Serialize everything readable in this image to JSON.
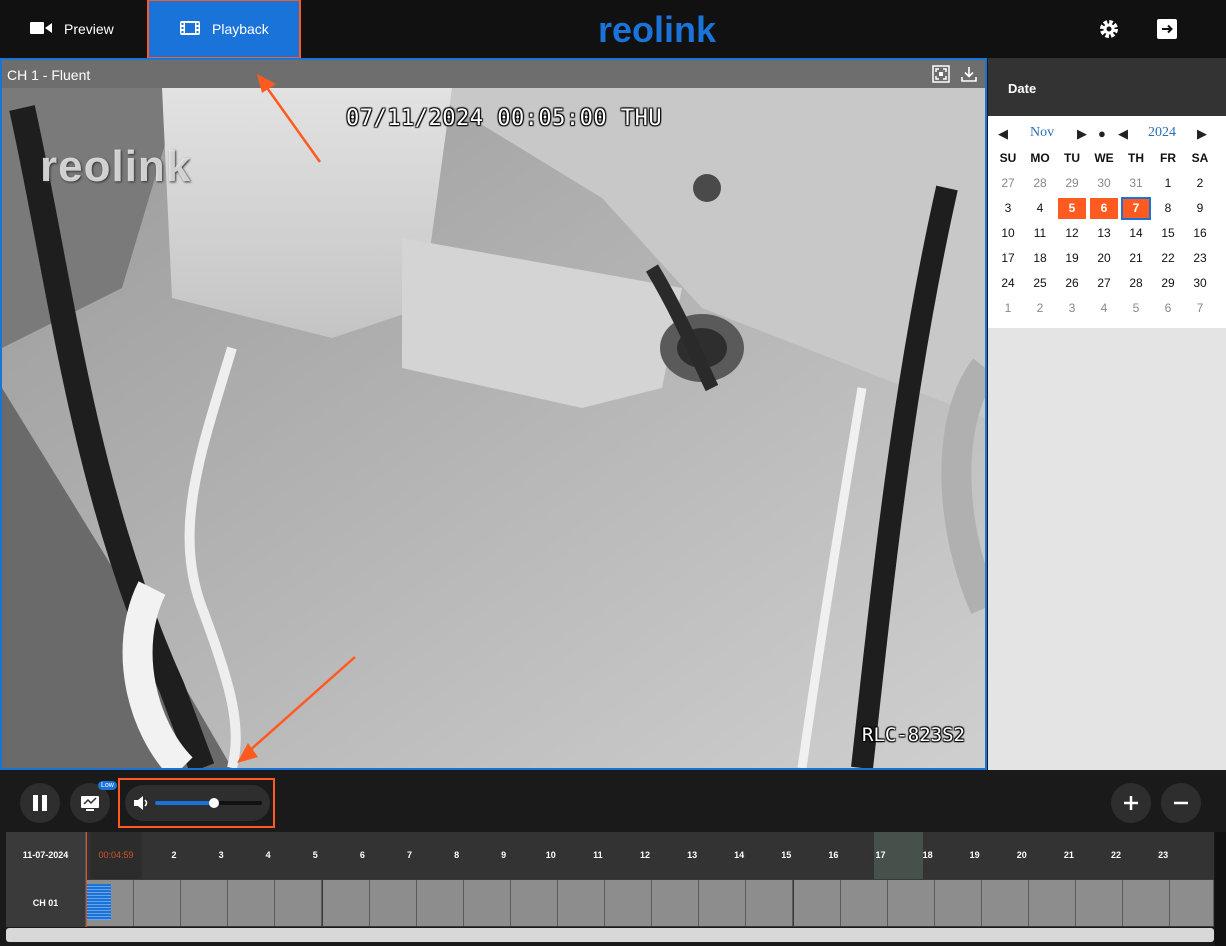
{
  "nav": {
    "preview_label": "Preview",
    "playback_label": "Playback",
    "logo_text": "reolink"
  },
  "video": {
    "title": "CH 1 - Fluent",
    "osd_timestamp": "07/11/2024 00:05:00 THU",
    "osd_model": "RLC-823S2",
    "osd_logo": "reolink"
  },
  "calendar": {
    "header": "Date",
    "month": "Nov",
    "year": "2024",
    "weekdays": [
      "SU",
      "MO",
      "TU",
      "WE",
      "TH",
      "FR",
      "SA"
    ],
    "weeks": [
      [
        "27",
        "28",
        "29",
        "30",
        "31",
        "1",
        "2"
      ],
      [
        "3",
        "4",
        "5",
        "6",
        "7",
        "8",
        "9"
      ],
      [
        "10",
        "11",
        "12",
        "13",
        "14",
        "15",
        "16"
      ],
      [
        "17",
        "18",
        "19",
        "20",
        "21",
        "22",
        "23"
      ],
      [
        "24",
        "25",
        "26",
        "27",
        "28",
        "29",
        "30"
      ],
      [
        "1",
        "2",
        "3",
        "4",
        "5",
        "6",
        "7"
      ]
    ],
    "recorded_days": [
      "5",
      "6",
      "7"
    ],
    "selected_day": "7"
  },
  "controls": {
    "stream_badge": "Low",
    "volume_fraction": 0.55
  },
  "timeline": {
    "date": "11-07-2024",
    "current_time": "00:04:59",
    "hours": [
      "2",
      "3",
      "4",
      "5",
      "6",
      "7",
      "8",
      "9",
      "10",
      "11",
      "12",
      "13",
      "14",
      "15",
      "16",
      "17",
      "18",
      "19",
      "20",
      "21",
      "22",
      "23"
    ],
    "channel": "CH 01"
  },
  "colors": {
    "accent": "#1a73d8",
    "annotation": "#ff5a1f",
    "record_day": "#ff5a1f"
  }
}
